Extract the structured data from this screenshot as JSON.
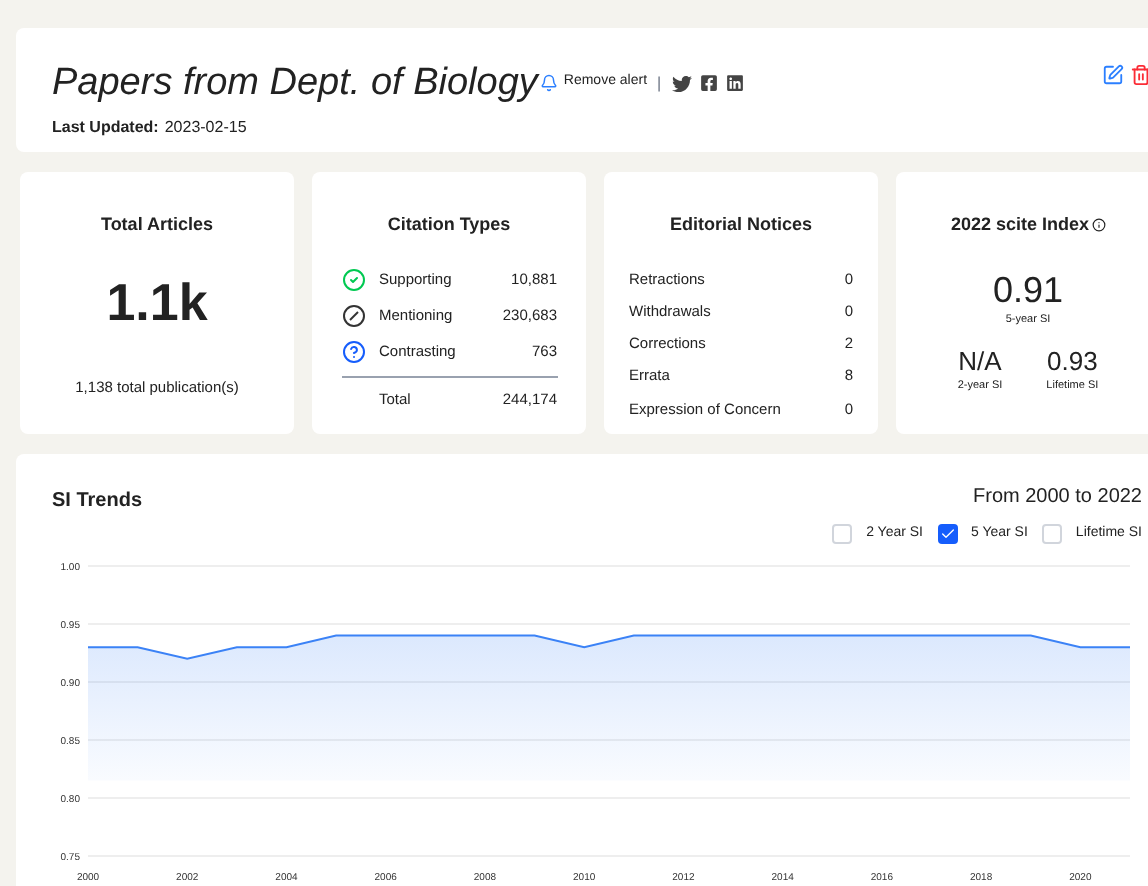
{
  "header": {
    "title": "Papers from Dept. of Biology",
    "alert_link": "Remove alert",
    "separator": "|",
    "last_updated_label": "Last Updated:",
    "last_updated": "2023-02-15"
  },
  "total_articles": {
    "title": "Total Articles",
    "value": "1.1k",
    "caption": "1,138 total publication(s)"
  },
  "citation_types": {
    "title": "Citation Types",
    "rows": [
      {
        "kind": "supporting",
        "label": "Supporting",
        "value": "10,881"
      },
      {
        "kind": "mentioning",
        "label": "Mentioning",
        "value": "230,683"
      },
      {
        "kind": "contrasting",
        "label": "Contrasting",
        "value": "763"
      }
    ],
    "total_label": "Total",
    "total_value": "244,174"
  },
  "editorial_notices": {
    "title": "Editorial Notices",
    "rows": [
      {
        "label": "Retractions",
        "value": "0"
      },
      {
        "label": "Withdrawals",
        "value": "0"
      },
      {
        "label": "Corrections",
        "value": "2"
      },
      {
        "label": "Errata",
        "value": "8"
      },
      {
        "label": "Expression of Concern",
        "value": "0"
      }
    ]
  },
  "scite_index": {
    "title": "2022 scite Index",
    "main_value": "0.91",
    "main_label": "5-year SI",
    "secondary": [
      {
        "value": "N/A",
        "label": "2-year SI"
      },
      {
        "value": "0.93",
        "label": "Lifetime SI"
      }
    ]
  },
  "si_trends": {
    "title": "SI Trends",
    "range": "From 2000 to 2022",
    "legend": [
      {
        "label": "2 Year SI",
        "checked": false
      },
      {
        "label": "5 Year SI",
        "checked": true
      },
      {
        "label": "Lifetime SI",
        "checked": false
      }
    ],
    "chart_data": {
      "type": "area",
      "x": [
        2000,
        2001,
        2002,
        2003,
        2004,
        2005,
        2006,
        2007,
        2008,
        2009,
        2010,
        2011,
        2012,
        2013,
        2014,
        2015,
        2016,
        2017,
        2018,
        2019,
        2020,
        2021
      ],
      "series": [
        {
          "color": "#3b82f6",
          "values": [
            0.93,
            0.93,
            0.92,
            0.93,
            0.93,
            0.94,
            0.94,
            0.94,
            0.94,
            0.94,
            0.93,
            0.94,
            0.94,
            0.94,
            0.94,
            0.94,
            0.94,
            0.94,
            0.94,
            0.94,
            0.93,
            0.93
          ]
        }
      ],
      "xlim": [
        2000,
        2021
      ],
      "ylim": [
        0.75,
        1.0
      ],
      "grid": true,
      "yticks": [
        {
          "value": 1.0,
          "label": "1.00"
        },
        {
          "value": 0.95,
          "label": "0.95"
        },
        {
          "value": 0.9,
          "label": "0.90"
        },
        {
          "value": 0.85,
          "label": "0.85"
        },
        {
          "value": 0.8,
          "label": "0.80"
        },
        {
          "value": 0.75,
          "label": "0.75"
        }
      ],
      "xticks": [
        2000,
        2002,
        2004,
        2006,
        2008,
        2010,
        2012,
        2014,
        2016,
        2018,
        2020
      ]
    }
  }
}
